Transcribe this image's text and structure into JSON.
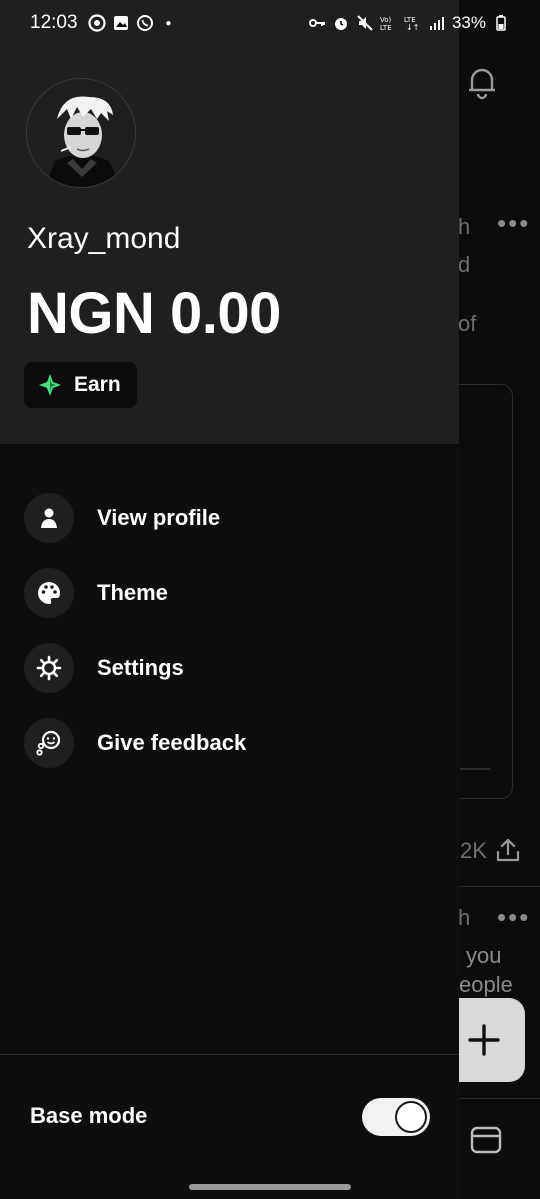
{
  "status_bar": {
    "time": "12:03",
    "battery": "33%"
  },
  "drawer": {
    "username": "Xray_mond",
    "balance": "NGN 0.00",
    "earn_label": "Earn",
    "menu": [
      {
        "label": "View profile",
        "icon": "person-icon"
      },
      {
        "label": "Theme",
        "icon": "palette-icon"
      },
      {
        "label": "Settings",
        "icon": "gear-icon"
      },
      {
        "label": "Give feedback",
        "icon": "feedback-icon"
      }
    ],
    "base_mode_label": "Base mode",
    "base_mode_on": true
  },
  "background": {
    "fragments": [
      "h",
      "d",
      "of",
      "2K",
      "h",
      "you",
      "eople"
    ]
  },
  "colors": {
    "drawer_bg": "#0e0e10",
    "header_bg": "#1f1f22",
    "earn_icon": "#4ade80"
  }
}
